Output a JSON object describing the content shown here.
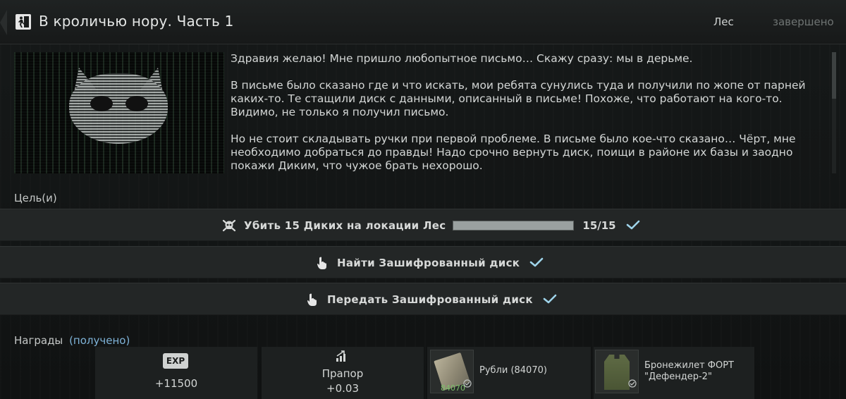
{
  "header": {
    "title": "В кроличью нору. Часть 1",
    "location": "Лес",
    "status": "завершено"
  },
  "description": {
    "paragraphs": [
      "Здравия желаю! Мне пришло любопытное письмо… Скажу сразу: мы в дерьме.",
      "В письме было сказано где и что искать, мои ребята сунулись туда и получили по жопе от парней каких-то. Те стащили диск с данными, описанный в письме! Похоже, что работают на кого-то. Видимо, не только я получил письмо.",
      "Но не стоит складывать ручки при первой проблеме. В письме было кое-что сказано… Чёрт, мне необходимо добраться до правды! Надо срочно вернуть диск, поищи в районе их базы и заодно покажи Диким, что чужое брать нехорошо."
    ]
  },
  "objectives": {
    "label": "Цель(и)",
    "items": [
      {
        "text": "Убить 15 Диких на локации Лес",
        "icon": "skull-crossbones-icon",
        "progress": 1.0,
        "count": "15/15",
        "done": true
      },
      {
        "text": "Найти Зашифрованный диск",
        "icon": "hand-pointer-icon",
        "done": true
      },
      {
        "text": "Передать Зашифрованный диск",
        "icon": "hand-pointer-icon",
        "done": true
      }
    ]
  },
  "rewards": {
    "label": "Награды",
    "status": "(получено)",
    "exp": {
      "badge": "EXP",
      "value": "+11500"
    },
    "standing": {
      "trader": "Прапор",
      "value": "+0.03",
      "icon": "standing-up-icon"
    },
    "items": [
      {
        "name": "Рубли (84070)",
        "stack": "84070",
        "icon": "rubles-icon"
      },
      {
        "name": "Бронежилет ФОРТ \"Дефендер-2\"",
        "icon": "body-armor-icon"
      }
    ]
  },
  "colors": {
    "background": "#141616",
    "row": "#232626",
    "check": "#9fd4ea",
    "reward_status": "#7fb3d8",
    "stack": "#7dc06a"
  }
}
